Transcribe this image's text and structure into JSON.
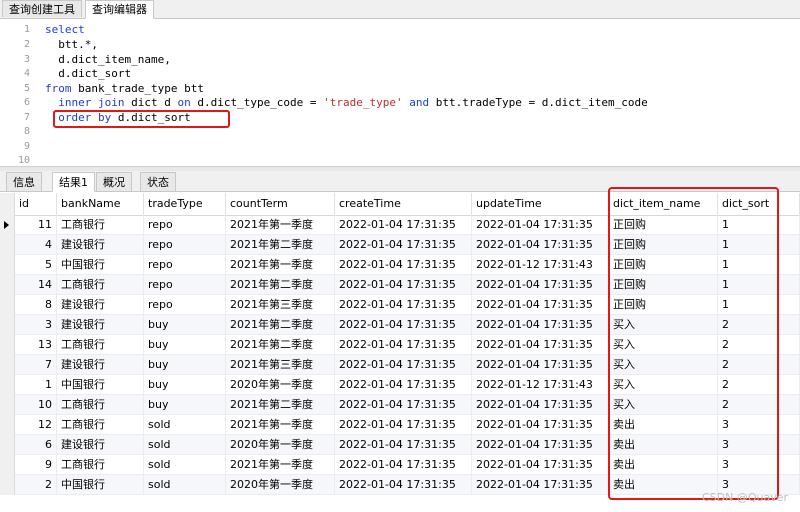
{
  "top_tabs": [
    "查询创建工具",
    "查询编辑器"
  ],
  "editor": {
    "line_numbers": [
      "1",
      "2",
      "3",
      "4",
      "5",
      "6",
      "7",
      "8",
      "9",
      "10"
    ]
  },
  "bottom_tabs": [
    "信息",
    "结果1",
    "概况",
    "状态"
  ],
  "table": {
    "columns": [
      "id",
      "bankName",
      "tradeType",
      "countTerm",
      "createTime",
      "updateTime",
      "dict_item_name",
      "dict_sort"
    ],
    "rows": [
      [
        "11",
        "工商银行",
        "repo",
        "2021年第一季度",
        "2022-01-04 17:31:35",
        "2022-01-04 17:31:35",
        "正回购",
        "1"
      ],
      [
        "4",
        "建设银行",
        "repo",
        "2021年第二季度",
        "2022-01-04 17:31:35",
        "2022-01-04 17:31:35",
        "正回购",
        "1"
      ],
      [
        "5",
        "中国银行",
        "repo",
        "2021年第一季度",
        "2022-01-04 17:31:35",
        "2022-01-12 17:31:43",
        "正回购",
        "1"
      ],
      [
        "14",
        "工商银行",
        "repo",
        "2021年第二季度",
        "2022-01-04 17:31:35",
        "2022-01-04 17:31:35",
        "正回购",
        "1"
      ],
      [
        "8",
        "建设银行",
        "repo",
        "2021年第三季度",
        "2022-01-04 17:31:35",
        "2022-01-04 17:31:35",
        "正回购",
        "1"
      ],
      [
        "3",
        "建设银行",
        "buy",
        "2021年第二季度",
        "2022-01-04 17:31:35",
        "2022-01-04 17:31:35",
        "买入",
        "2"
      ],
      [
        "13",
        "工商银行",
        "buy",
        "2021年第二季度",
        "2022-01-04 17:31:35",
        "2022-01-04 17:31:35",
        "买入",
        "2"
      ],
      [
        "7",
        "建设银行",
        "buy",
        "2021年第三季度",
        "2022-01-04 17:31:35",
        "2022-01-04 17:31:35",
        "买入",
        "2"
      ],
      [
        "1",
        "中国银行",
        "buy",
        "2020年第一季度",
        "2022-01-04 17:31:35",
        "2022-01-12 17:31:43",
        "买入",
        "2"
      ],
      [
        "10",
        "工商银行",
        "buy",
        "2021年第二季度",
        "2022-01-04 17:31:35",
        "2022-01-04 17:31:35",
        "买入",
        "2"
      ],
      [
        "12",
        "工商银行",
        "sold",
        "2021年第一季度",
        "2022-01-04 17:31:35",
        "2022-01-04 17:31:35",
        "卖出",
        "3"
      ],
      [
        "6",
        "建设银行",
        "sold",
        "2020年第一季度",
        "2022-01-04 17:31:35",
        "2022-01-04 17:31:35",
        "卖出",
        "3"
      ],
      [
        "9",
        "工商银行",
        "sold",
        "2021年第一季度",
        "2022-01-04 17:31:35",
        "2022-01-04 17:31:35",
        "卖出",
        "3"
      ],
      [
        "2",
        "中国银行",
        "sold",
        "2020年第一季度",
        "2022-01-04 17:31:35",
        "2022-01-04 17:31:35",
        "卖出",
        "3"
      ]
    ]
  },
  "watermark": "CSDN @Quaver",
  "colors": {
    "keyword": "#1e3dd6",
    "string": "#c03030",
    "highlight_border": "#e01818"
  }
}
